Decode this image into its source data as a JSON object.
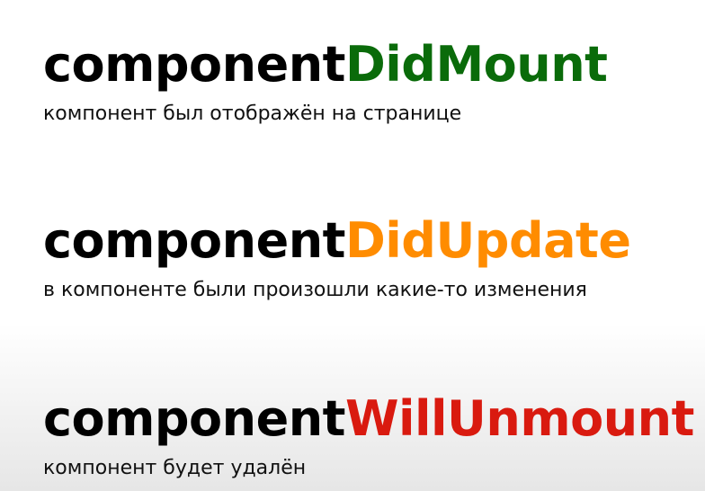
{
  "methods": [
    {
      "prefix": "component",
      "suffix": "DidMount",
      "suffix_color": "#0a6b0a",
      "description": "компонент был отображён на странице"
    },
    {
      "prefix": "component",
      "suffix": "DidUpdate",
      "suffix_color": "#ff8c00",
      "description": "в компоненте были произошли какие-то изменения"
    },
    {
      "prefix": "component",
      "suffix": "WillUnmount",
      "suffix_color": "#d91a0f",
      "description": "компонент будет удалён"
    }
  ]
}
